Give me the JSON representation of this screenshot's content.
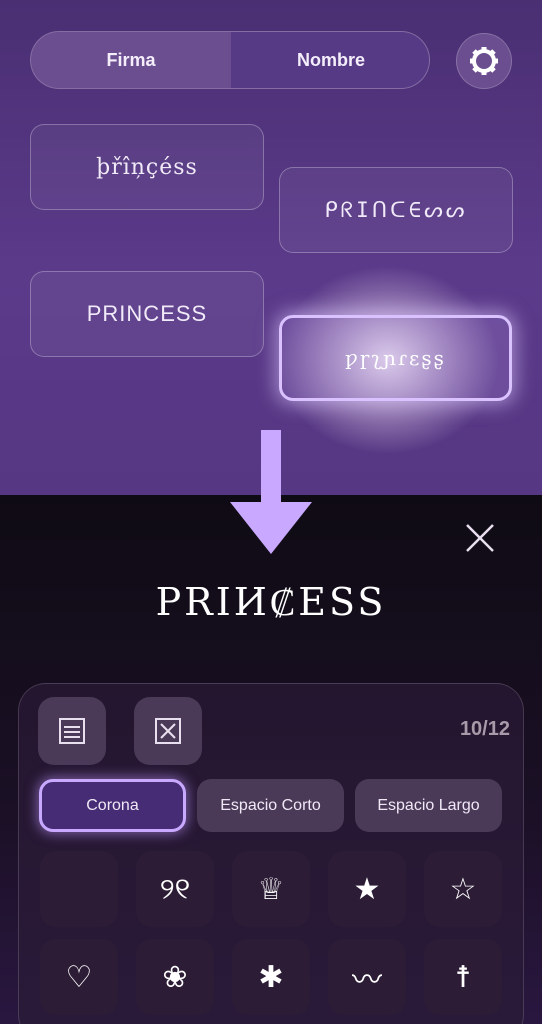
{
  "toggle": {
    "left_label": "Firma",
    "right_label": "Nombre"
  },
  "styles": [
    {
      "text": "þřîņçéss"
    },
    {
      "text": "ᑭᖇIᑎᑕ∈ᔕᔕ"
    },
    {
      "text": "PRINCESS"
    },
    {
      "text": "ƿɼʅɲɾεʂʂ"
    }
  ],
  "result_text": "PRIИ₡ESS",
  "counter": "10/12",
  "categories": [
    "Corona",
    "Espacio Corto",
    "Espacio Largo"
  ],
  "symbols_row1": [
    "",
    "୨୧",
    "♕",
    "★",
    "☆"
  ],
  "symbols_row2": [
    "♡",
    "❀",
    "✱",
    "〰",
    "☨"
  ],
  "colors": {
    "accent": "#c9a9ff",
    "top_bg": "#5b3a8a",
    "bottom_bg": "#120c1a"
  }
}
